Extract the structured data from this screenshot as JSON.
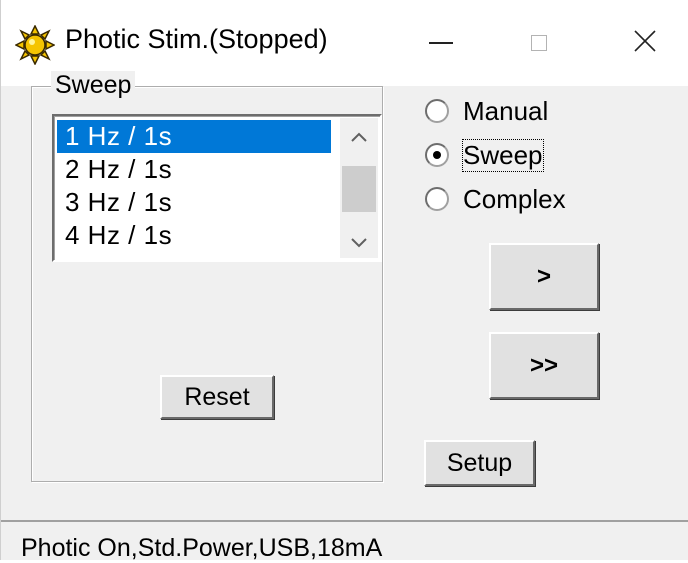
{
  "window": {
    "title": "Photic Stim.(Stopped)",
    "app_icon": "sun-icon",
    "controls": {
      "minimize_icon": "minimize-icon",
      "maximize_icon": "maximize-icon",
      "close_icon": "close-icon",
      "close_glyph": "✕"
    }
  },
  "sweep_group": {
    "label": "Sweep",
    "list": {
      "items": [
        "1 Hz / 1s",
        "2 Hz / 1s",
        "3 Hz / 1s",
        "4 Hz / 1s"
      ],
      "selected_index": 0,
      "scroll_up_glyph": "⌃",
      "scroll_down_glyph": "⌄"
    },
    "reset_label": "Reset"
  },
  "mode": {
    "options": [
      "Manual",
      "Sweep",
      "Complex"
    ],
    "selected": "Sweep"
  },
  "buttons": {
    "next_label": ">",
    "fast_label": ">>",
    "setup_label": "Setup"
  },
  "status": {
    "text": "Photic On,Std.Power,USB,18mA"
  },
  "colors": {
    "selection": "#0078d7",
    "window_bg": "#f0f0f0",
    "sun_fill": "#f5c400",
    "sun_outline": "#3a2a00"
  }
}
